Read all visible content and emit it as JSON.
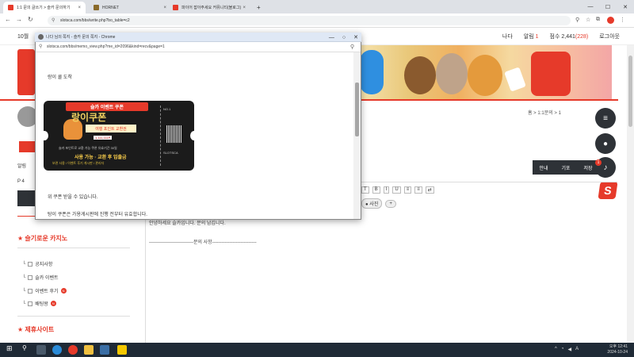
{
  "browser": {
    "tabs": [
      {
        "label": "1:1 문의 글쓰기 > 슬카 문의하기",
        "active": true,
        "favicon_color": "#e63a2a"
      },
      {
        "label": "HORNET",
        "active": false,
        "favicon_color": "#8a6a2a"
      },
      {
        "label": "파이어 잡아주세요 커뮤니티(블로그)",
        "active": false,
        "favicon_color": "#e63a2a"
      }
    ],
    "new_tab": "+",
    "address": "slotsca.com/bbs/write.php?bo_table=c2",
    "window_controls": {
      "minimize": "—",
      "maximize": "☐",
      "close": "✕"
    }
  },
  "site": {
    "date": "10월",
    "userbar": {
      "name": "나다",
      "alerts_label": "알림",
      "alerts_count": "1",
      "points_label": "점수",
      "points_value": "2,441",
      "points_extra": "(228)",
      "logout": "로그아웃"
    },
    "breadcrumb": "홈 > 1:1문의 > 1",
    "content_tabs": [
      "안내",
      "기포",
      "저장"
    ],
    "sidebar": {
      "line1": "알림",
      "line2": "P 4",
      "section1_title": "슬기로운 카지노",
      "section1_items": [
        {
          "label": "공지사항",
          "badge": ""
        },
        {
          "label": "슬카 이벤트",
          "badge": ""
        },
        {
          "label": "이벤트 후기",
          "badge": "N"
        },
        {
          "label": "배팅왕",
          "badge": "N"
        }
      ],
      "section2_title": "제휴사이트"
    },
    "editor": {
      "tools": [
        "T",
        "B",
        "I",
        "U",
        "≡",
        "≡",
        "⇄"
      ],
      "buttons": {
        "photo": "사진",
        "add": "+"
      },
      "text_line1": "안녕하세요 슬카입니다. 문의 남깁니다.",
      "text_line2": "----------------------------문의 사항----------------------------"
    },
    "notification_badge": "1",
    "brand_letter": "S"
  },
  "popup": {
    "title": "나다 님의 쪽지 - 슬카 문의 쪽지 - Chrome",
    "url": "slotsca.com/bbs/memo_view.php?me_id=2096&kind=recv&page=1",
    "body_line1": "랑이 쿨 도착",
    "body_line2": "위 쿠폰 받을 수 있습니다.",
    "body_line3": "탕이 쿠폰은 가용게시판에 진행 전부터 유효합니다.",
    "coupon": {
      "header": "슬카 이벤트 쿠폰",
      "main": "랑이쿠폰",
      "sub": "여행 포인트 교환권",
      "label": "1,111,111P",
      "fine1": "슬카 포인트로 교환 가능 쿠폰 유효기간 30일",
      "fine2": "사용 가능 · 교환 후 입출금",
      "fine3": "보관 사용 / 이벤트 후기 게시판 / 관리자",
      "stub_top": "NO.1",
      "stub_bottom": "SLOTSCA"
    }
  },
  "taskbar": {
    "time": "오후 12:41",
    "date": "2024-10-24"
  },
  "colors": {
    "brand_red": "#e63a2a",
    "dark": "#2e3237",
    "taskbar": "#1f2a36"
  }
}
